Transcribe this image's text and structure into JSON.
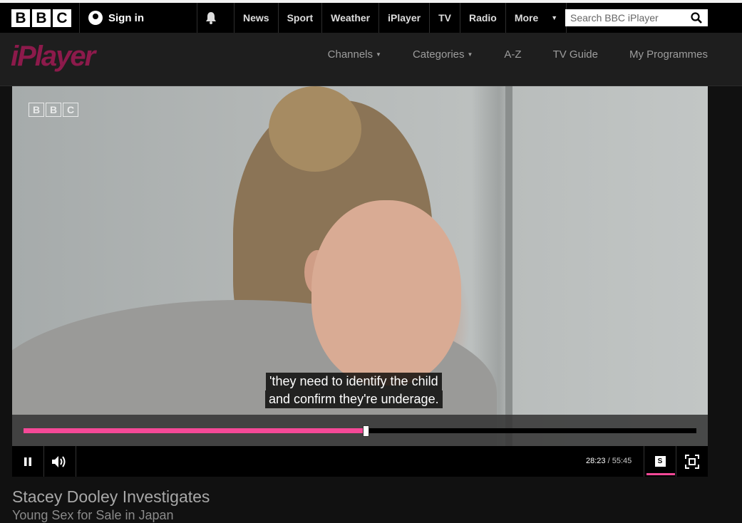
{
  "global_nav": {
    "logo_letters": [
      "B",
      "B",
      "C"
    ],
    "sign_in": "Sign in",
    "links": [
      "News",
      "Sport",
      "Weather",
      "iPlayer",
      "TV",
      "Radio"
    ],
    "more": "More",
    "search_placeholder": "Search BBC iPlayer"
  },
  "iplayer_nav": {
    "logo": "iPlayer",
    "links": [
      {
        "label": "Channels",
        "has_caret": true
      },
      {
        "label": "Categories",
        "has_caret": true
      },
      {
        "label": "A-Z",
        "has_caret": false
      },
      {
        "label": "TV Guide",
        "has_caret": false
      },
      {
        "label": "My Programmes",
        "has_caret": false
      }
    ]
  },
  "player": {
    "watermark_letters": [
      "B",
      "B",
      "C"
    ],
    "subtitle_lines": [
      "'they need to identify the child",
      "and confirm they're underage."
    ],
    "progress_fraction": 0.509,
    "current_time": "28:23",
    "duration": "/ 55:45",
    "subtitles_toggle_label": "S",
    "accent_color": "#f54997"
  },
  "programme": {
    "title": "Stacey Dooley Investigates",
    "episode": "Young Sex for Sale in Japan"
  }
}
